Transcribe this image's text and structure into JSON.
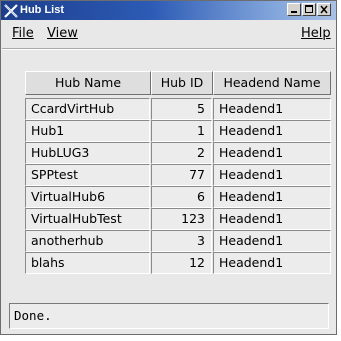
{
  "window": {
    "title": "Hub List",
    "controls": [
      "minimize-icon",
      "maximize-icon",
      "close-icon"
    ]
  },
  "menubar": {
    "file": "File",
    "view": "View",
    "help": "Help"
  },
  "table": {
    "columns": [
      "Hub Name",
      "Hub ID",
      "Headend Name"
    ],
    "rows": [
      {
        "name": "CcardVirtHub",
        "id": "5",
        "headend": "Headend1"
      },
      {
        "name": "Hub1",
        "id": "1",
        "headend": "Headend1"
      },
      {
        "name": "HubLUG3",
        "id": "2",
        "headend": "Headend1"
      },
      {
        "name": "SPPtest",
        "id": "77",
        "headend": "Headend1"
      },
      {
        "name": "VirtualHub6",
        "id": "6",
        "headend": "Headend1"
      },
      {
        "name": "VirtualHubTest",
        "id": "123",
        "headend": "Headend1"
      },
      {
        "name": "anotherhub",
        "id": "3",
        "headend": "Headend1"
      },
      {
        "name": "blahs",
        "id": "12",
        "headend": "Headend1"
      }
    ]
  },
  "status": {
    "text": "Done."
  }
}
